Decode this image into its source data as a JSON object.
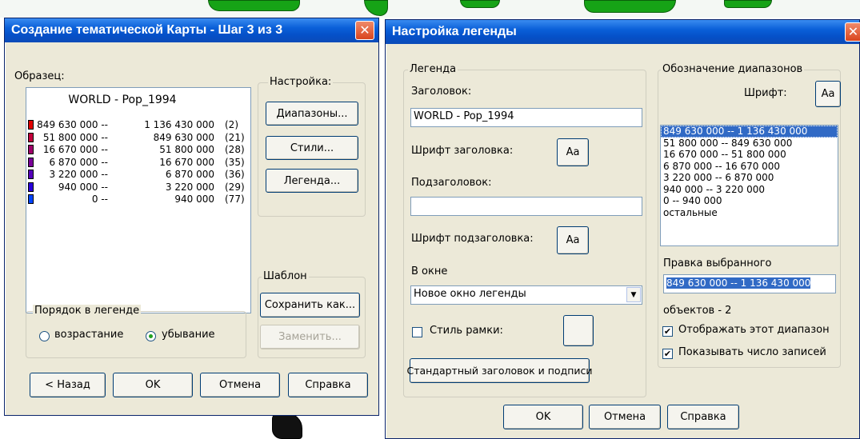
{
  "colors": {
    "title_bar": "#0a5fd8",
    "selection": "#316ac5",
    "map_land": "#16a316"
  },
  "wizard": {
    "title": "Создание тематической Карты - Шаг 3 из 3",
    "close_glyph": "✕",
    "sample_label": "Образец:",
    "sample_title": "WORLD - Pop_1994",
    "legend_rows": [
      {
        "lo": "849 630 000 --",
        "hi": "1 136 430 000",
        "count": "(2)",
        "color": "#e00000"
      },
      {
        "lo": "51 800 000 --",
        "hi": "849 630 000",
        "count": "(21)",
        "color": "#c4003c"
      },
      {
        "lo": "16 670 000 --",
        "hi": "51 800 000",
        "count": "(28)",
        "color": "#a0006a"
      },
      {
        "lo": "6 870 000 --",
        "hi": "16 670 000",
        "count": "(35)",
        "color": "#7a0099"
      },
      {
        "lo": "3 220 000 --",
        "hi": "6 870 000",
        "count": "(36)",
        "color": "#5500bb"
      },
      {
        "lo": "940 000 --",
        "hi": "3 220 000",
        "count": "(29)",
        "color": "#2a00dd"
      },
      {
        "lo": "0 --",
        "hi": "940 000",
        "count": "(77)",
        "color": "#0044ff"
      }
    ],
    "settings_group": "Настройка:",
    "ranges_btn": "Диапазоны...",
    "styles_btn": "Стили...",
    "legend_btn": "Легенда...",
    "template_group": "Шаблон",
    "save_btn": "Сохранить как...",
    "replace_btn": "Заменить...",
    "order_group": "Порядок в легенде",
    "ascending": "возрастание",
    "descending": "убывание",
    "back_btn": "< Назад",
    "ok_btn": "OK",
    "cancel_btn": "Отмена",
    "help_btn": "Справка"
  },
  "legend_dialog": {
    "title": "Настройка легенды",
    "close_glyph": "✕",
    "legend_group": "Легенда",
    "heading_label": "Заголовок:",
    "heading_value": "WORLD - Pop_1994",
    "heading_font_label": "Шрифт заголовка:",
    "font_btn": "Aa",
    "subheading_label": "Подзаголовок:",
    "subheading_value": "",
    "subheading_font_label": "Шрифт подзаголовка:",
    "in_window_label": "В окне",
    "in_window_value": "Новое окно легенды",
    "dropdown_glyph": "▼",
    "frame_style_label": "Стиль рамки:",
    "default_btn": "Стандартный заголовок и подписи",
    "ranges_group": "Обозначение диапазонов",
    "font_label": "Шрифт:",
    "ranges_list": [
      "849 630 000 -- 1 136 430 000",
      "51 800 000 -- 849 630 000",
      "16 670 000 -- 51 800 000",
      "6 870 000 -- 16 670 000",
      "3 220 000 -- 6 870 000",
      "940 000 -- 3 220 000",
      "0 -- 940 000",
      "остальные"
    ],
    "edit_label": "Правка выбранного",
    "edit_value": "849 630 000 -- 1 136 430 000",
    "objects_label": "объектов - 2",
    "show_range_label": "Отображать этот диапазон",
    "show_count_label": "Показывать число записей",
    "check_glyph": "✔",
    "ok_btn": "OK",
    "cancel_btn": "Отмена",
    "help_btn": "Справка"
  }
}
